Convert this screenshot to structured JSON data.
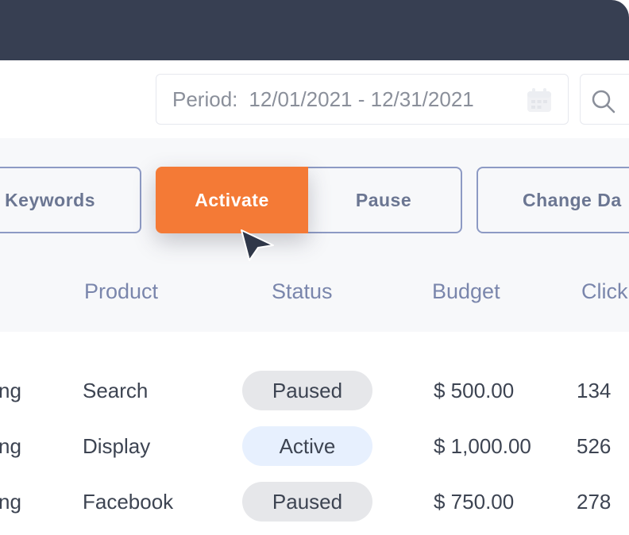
{
  "filter": {
    "period_label": "Period:",
    "period_value": "12/01/2021 - 12/31/2021"
  },
  "toolbar": {
    "keywords_label": "Keywords",
    "activate_label": "Activate",
    "pause_label": "Pause",
    "change_label": "Change Da"
  },
  "table": {
    "columns": [
      "Product",
      "Status",
      "Budget",
      "Click"
    ],
    "rows": [
      {
        "name": "ng",
        "product": "Search",
        "status": "Paused",
        "budget": "$ 500.00",
        "clicks": "134"
      },
      {
        "name": "ng",
        "product": "Display",
        "status": "Active",
        "budget": "$ 1,000.00",
        "clicks": "526"
      },
      {
        "name": "ng",
        "product": "Facebook",
        "status": "Paused",
        "budget": "$ 750.00",
        "clicks": "278"
      }
    ]
  },
  "colors": {
    "titlebar": "#373f52",
    "accent": "#f47a36",
    "header_text": "#7a86ac",
    "paused_pill": "#e6e7ea",
    "active_pill": "#e7f0fe"
  },
  "icons": [
    "calendar-icon",
    "search-icon",
    "cursor-arrow-icon"
  ]
}
